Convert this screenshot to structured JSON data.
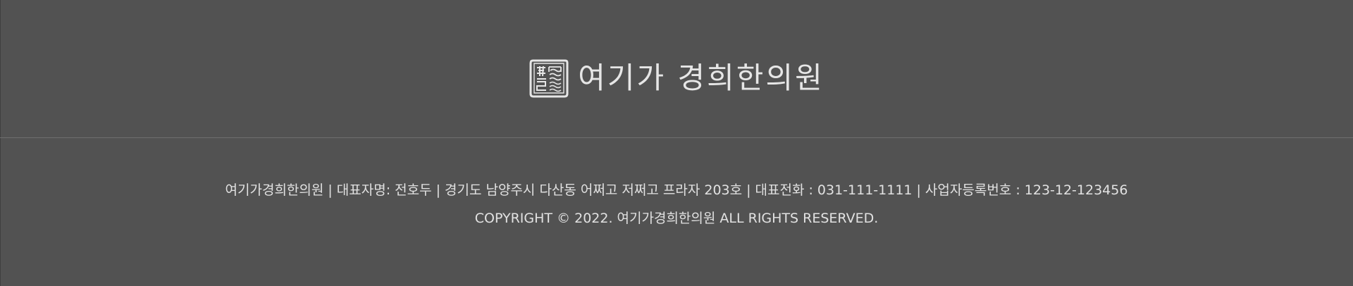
{
  "colors": {
    "background": "#525252",
    "text": "#e2e2e2",
    "divider": "#6e6e6e"
  },
  "header": {
    "logo": {
      "icon": "seal-stamp-icon",
      "text": "여기가 경희한의원"
    }
  },
  "footer": {
    "info": {
      "clinic_name": "여기가경희한의원",
      "representative": "대표자명: 전호두",
      "address": "경기도 남양주시 다산동 어쩌고 저쩌고 프라자 203호",
      "phone": "대표전화 : 031-111-1111",
      "business_number": "사업자등록번호 : 123-12-123456",
      "separator": "|"
    },
    "copyright": "COPYRIGHT © 2022. 여기가경희한의원 ALL RIGHTS RESERVED."
  }
}
